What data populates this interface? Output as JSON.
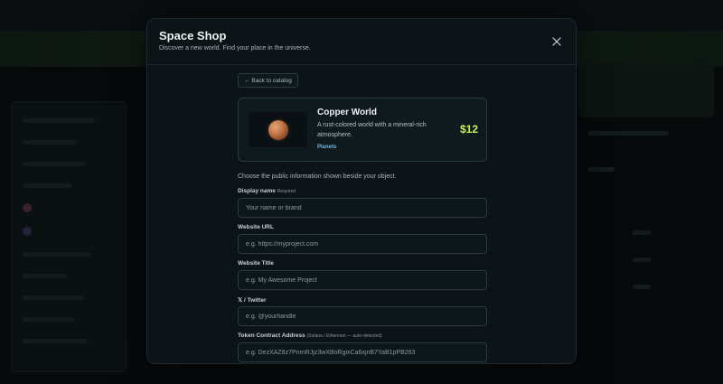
{
  "modal": {
    "title": "Space Shop",
    "subtitle": "Discover a new world. Find your place in the universe."
  },
  "back_button": {
    "label": "← Back to catalog"
  },
  "product": {
    "name": "Copper World",
    "description": "A rust-colored world with a mineral-rich atmosphere.",
    "category": "Planets",
    "price": "$12"
  },
  "form": {
    "intro": "Choose the public information shown beside your object.",
    "display_name": {
      "label": "Display name",
      "note": "Required",
      "placeholder": "Your name or brand"
    },
    "website_url": {
      "label": "Website URL",
      "placeholder": "e.g. https://myproject.com"
    },
    "website_title": {
      "label": "Website Title",
      "placeholder": "e.g. My Awesome Project"
    },
    "twitter": {
      "label": "𝕏 / Twitter",
      "placeholder": "e.g. @yourhandle"
    },
    "token": {
      "label": "Token Contract Address",
      "note": "(Solana / Ethereum — auto-detected)",
      "placeholder": "e.g. DezXAZ8z7PnrnRJjz3wXBoRgixCa6xjnB7YaB1pPB263"
    }
  },
  "colors": {
    "accent_price": "#c6f25a",
    "tag_blue": "#6fb6e0",
    "modal_bg": "#0c1418"
  }
}
